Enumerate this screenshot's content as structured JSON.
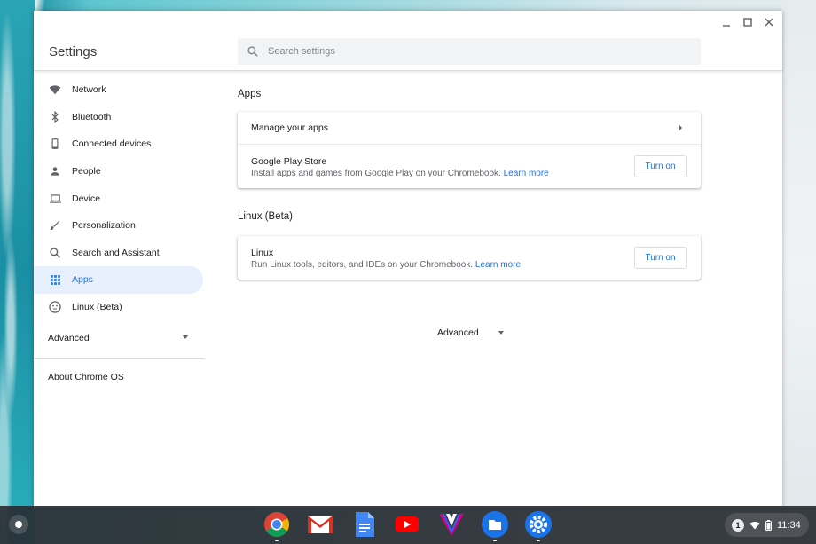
{
  "window": {
    "title": "Settings",
    "search_placeholder": "Search settings",
    "controls": [
      "minimize-icon",
      "maximize-icon",
      "close-icon"
    ]
  },
  "sidebar": {
    "items": [
      {
        "label": "Network",
        "icon": "wifi-icon"
      },
      {
        "label": "Bluetooth",
        "icon": "bluetooth-icon"
      },
      {
        "label": "Connected devices",
        "icon": "phone-icon"
      },
      {
        "label": "People",
        "icon": "person-icon"
      },
      {
        "label": "Device",
        "icon": "laptop-icon"
      },
      {
        "label": "Personalization",
        "icon": "brush-icon"
      },
      {
        "label": "Search and Assistant",
        "icon": "search-icon"
      },
      {
        "label": "Apps",
        "icon": "apps-grid-icon",
        "active": true
      },
      {
        "label": "Linux (Beta)",
        "icon": "penguin-icon"
      }
    ],
    "advanced_label": "Advanced",
    "about_label": "About Chrome OS"
  },
  "main": {
    "apps_section": {
      "title": "Apps",
      "manage_label": "Manage your apps",
      "play_store": {
        "title": "Google Play Store",
        "description": "Install apps and games from Google Play on your Chromebook.",
        "link": "Learn more",
        "button": "Turn on"
      }
    },
    "linux_section": {
      "title": "Linux (Beta)",
      "linux": {
        "title": "Linux",
        "description": "Run Linux tools, editors, and IDEs on your Chromebook.",
        "link": "Learn more",
        "button": "Turn on"
      }
    },
    "advanced_label": "Advanced"
  },
  "shelf": {
    "apps": [
      "chrome-icon",
      "gmail-icon",
      "docs-icon",
      "youtube-icon",
      "vanced-icon",
      "files-icon",
      "settings-icon"
    ],
    "tray": {
      "notification_count": "1",
      "time": "11:34"
    }
  },
  "colors": {
    "accent": "#1a73e8",
    "active_bg": "#e8f0fe",
    "shelf": "#2b2f35"
  }
}
